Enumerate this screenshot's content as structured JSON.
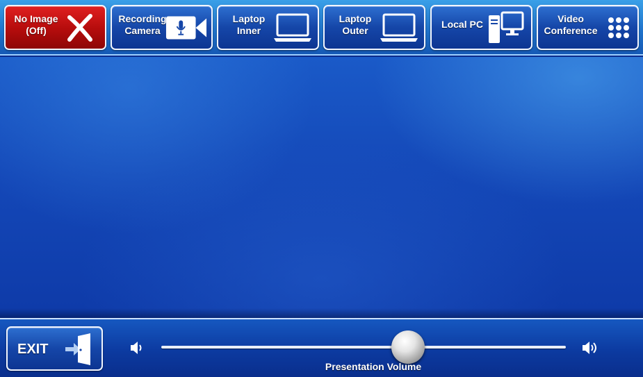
{
  "sources": [
    {
      "id": "no-image",
      "label": "No Image\n(Off)",
      "icon": "x-mark-icon",
      "style": "red"
    },
    {
      "id": "recording-camera",
      "label": "Recording\nCamera",
      "icon": "video-camera-icon",
      "style": "blue"
    },
    {
      "id": "laptop-inner",
      "label": "Laptop\nInner",
      "icon": "laptop-icon",
      "style": "blue"
    },
    {
      "id": "laptop-outer",
      "label": "Laptop\nOuter",
      "icon": "laptop-icon",
      "style": "blue"
    },
    {
      "id": "local-pc",
      "label": "Local PC",
      "icon": "desktop-pc-icon",
      "style": "blue"
    },
    {
      "id": "video-conference",
      "label": "Video\nConference",
      "icon": "keypad-icon",
      "style": "blue"
    }
  ],
  "exit": {
    "label": "EXIT",
    "icon": "exit-door-icon"
  },
  "volume": {
    "label": "Presentation Volume",
    "level_percent": 61,
    "min_icon": "speaker-low-icon",
    "max_icon": "speaker-high-icon"
  },
  "colors": {
    "button_blue": "#1546a8",
    "button_red": "#b80d0d",
    "background_blue": "#1448b8"
  }
}
